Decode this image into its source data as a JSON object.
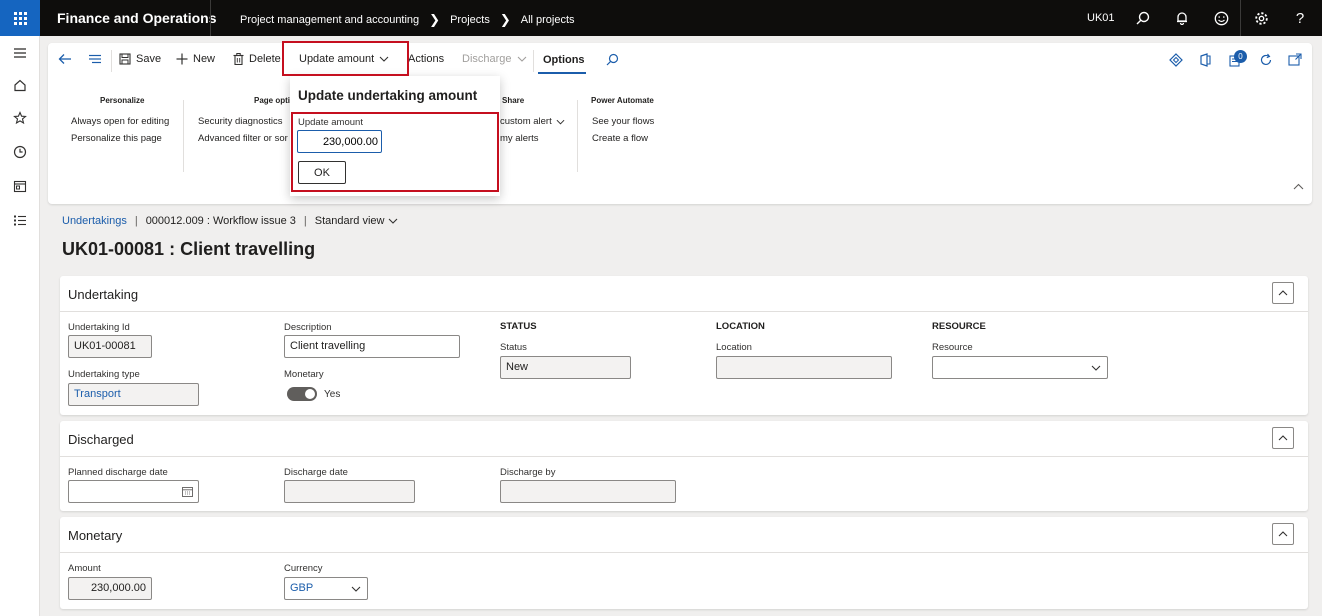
{
  "topbar": {
    "app_title": "Finance and Operations",
    "breadcrumb": [
      "Project management and accounting",
      "Projects",
      "All projects"
    ],
    "company": "UK01",
    "icons": [
      "search-icon",
      "bell-icon",
      "smiley-icon",
      "gear-icon",
      "help-icon"
    ]
  },
  "leftnav": {
    "icons": [
      "hamburger-icon",
      "home-icon",
      "star-icon",
      "clock-icon",
      "workspace-icon",
      "list-icon"
    ]
  },
  "toolbar": {
    "save": "Save",
    "new": "New",
    "delete": "Delete",
    "update_amount": "Update amount",
    "actions": "Actions",
    "discharge": "Discharge",
    "options": "Options",
    "badge_count": "0"
  },
  "options_groups": {
    "personalize": {
      "title": "Personalize",
      "items": [
        "Always open for editing",
        "Personalize this page"
      ]
    },
    "page_options": {
      "title": "Page opti",
      "items": [
        "Security diagnostics",
        "Advanced filter or sor"
      ]
    },
    "share": {
      "title": "Share",
      "items": [
        "custom alert",
        "my alerts"
      ]
    },
    "power_automate": {
      "title": "Power Automate",
      "items": [
        "See your flows",
        "Create a flow"
      ]
    }
  },
  "flyout": {
    "title": "Update undertaking amount",
    "label": "Update amount",
    "value": "230,000.00",
    "ok": "OK"
  },
  "breadcrumb": {
    "link": "Undertakings",
    "record": "000012.009 : Workflow issue 3",
    "view": "Standard view"
  },
  "page_title": "UK01-00081 : Client travelling",
  "undertaking": {
    "title": "Undertaking",
    "id_label": "Undertaking Id",
    "id_value": "UK01-00081",
    "type_label": "Undertaking type",
    "type_value": "Transport",
    "desc_label": "Description",
    "desc_value": "Client travelling",
    "monetary_label": "Monetary",
    "monetary_value": "Yes",
    "status_head": "STATUS",
    "status_label": "Status",
    "status_value": "New",
    "location_head": "LOCATION",
    "location_label": "Location",
    "location_value": "",
    "resource_head": "RESOURCE",
    "resource_label": "Resource",
    "resource_value": ""
  },
  "discharged": {
    "title": "Discharged",
    "planned_label": "Planned discharge date",
    "planned_value": "",
    "date_label": "Discharge date",
    "date_value": "",
    "by_label": "Discharge by",
    "by_value": ""
  },
  "monetary": {
    "title": "Monetary",
    "amount_label": "Amount",
    "amount_value": "230,000.00",
    "currency_label": "Currency",
    "currency_value": "GBP"
  },
  "colors": {
    "topbar": "#0e0d0c",
    "waffle": "#1565c0",
    "accent": "#1b5dab",
    "highlight": "#c50f1f"
  }
}
